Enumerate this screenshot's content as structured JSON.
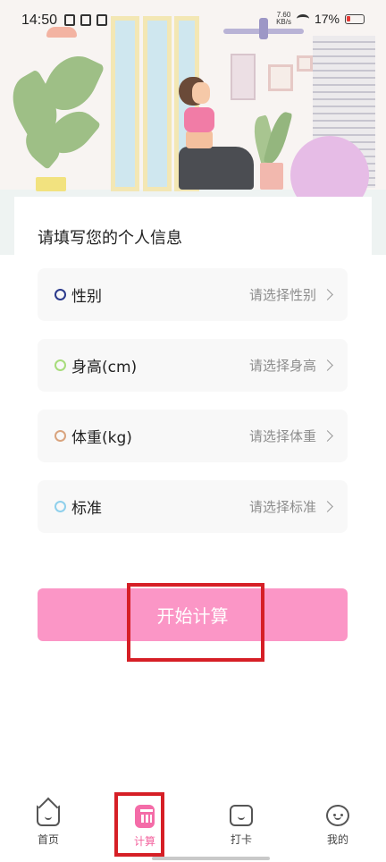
{
  "status_bar": {
    "time": "14:50",
    "speed_top": "7.60",
    "speed_unit": "KB/s",
    "battery_text": "17%"
  },
  "form": {
    "title": "请填写您的个人信息",
    "fields": [
      {
        "label": "性别",
        "placeholder": "请选择性别",
        "dot_color": "#2b3a8c"
      },
      {
        "label": "身高(cm)",
        "placeholder": "请选择身高",
        "dot_color": "#a7dc7b"
      },
      {
        "label": "体重(kg)",
        "placeholder": "请选择体重",
        "dot_color": "#d9a47e"
      },
      {
        "label": "标准",
        "placeholder": "请选择标准",
        "dot_color": "#8fd0ec"
      }
    ],
    "start_button": "开始计算"
  },
  "bottom_nav": {
    "items": [
      {
        "label": "首页",
        "icon": "home-icon"
      },
      {
        "label": "计算",
        "icon": "calculator-icon",
        "active": true
      },
      {
        "label": "打卡",
        "icon": "checkin-icon"
      },
      {
        "label": "我的",
        "icon": "profile-icon"
      }
    ]
  },
  "colors": {
    "accent": "#fb96c6",
    "active_nav": "#f3649f",
    "highlight": "#d61f26"
  }
}
